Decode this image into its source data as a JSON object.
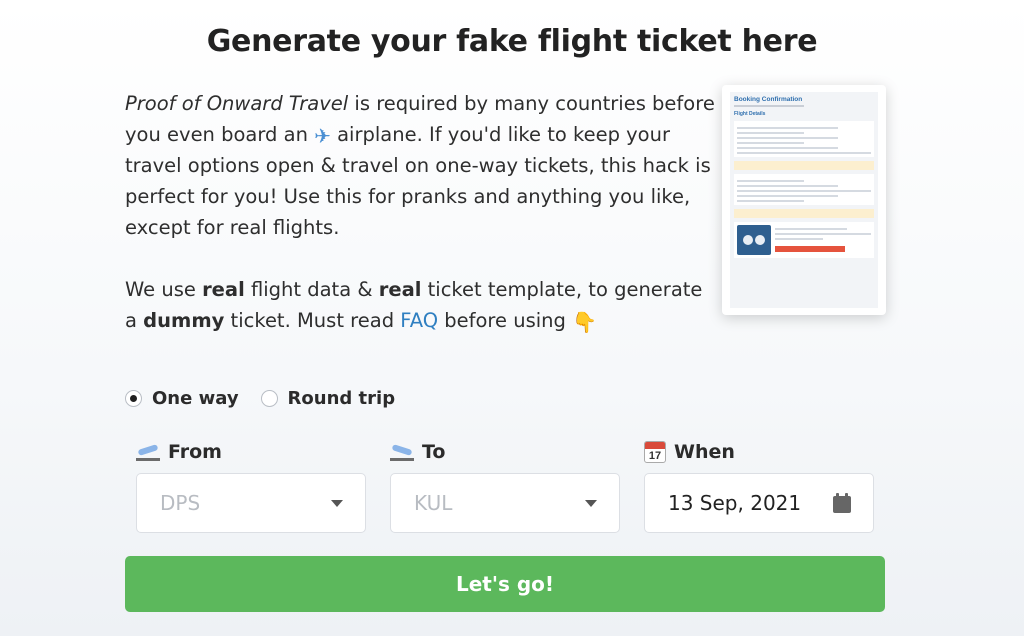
{
  "header": {
    "title": "Generate your fake flight ticket here"
  },
  "intro": {
    "p1_italic": "Proof of Onward Travel",
    "p1_a": " is required by many countries before you even board an ",
    "plane_emoji": "✈",
    "p1_b": " airplane. If you'd like to keep your travel options open & travel on one-way tickets, this hack is perfect for you! Use this for pranks and anything you like, except for real flights.",
    "p2_a": "We use ",
    "p2_b1": "real",
    "p2_c": " flight data & ",
    "p2_b2": "real",
    "p2_d": " ticket template, to generate a ",
    "p2_b3": "dummy",
    "p2_e": " ticket. Must read ",
    "faq_link": "FAQ",
    "p2_f": " before using ",
    "hand_emoji": "👇"
  },
  "preview": {
    "heading": "Booking Confirmation",
    "section": "Flight Details"
  },
  "trip_type": {
    "options": [
      {
        "label": "One way",
        "checked": true
      },
      {
        "label": "Round trip",
        "checked": false
      }
    ]
  },
  "fields": {
    "from": {
      "label": "From",
      "placeholder": "DPS",
      "icon": "departure-icon"
    },
    "to": {
      "label": "To",
      "placeholder": "KUL",
      "icon": "arrival-icon"
    },
    "when": {
      "label": "When",
      "value": "13 Sep, 2021",
      "icon": "calendar-icon",
      "icon_day": "17"
    }
  },
  "submit": {
    "label": "Let's go!"
  },
  "colors": {
    "accent": "#5cb85c",
    "link": "#2f7fc1"
  }
}
